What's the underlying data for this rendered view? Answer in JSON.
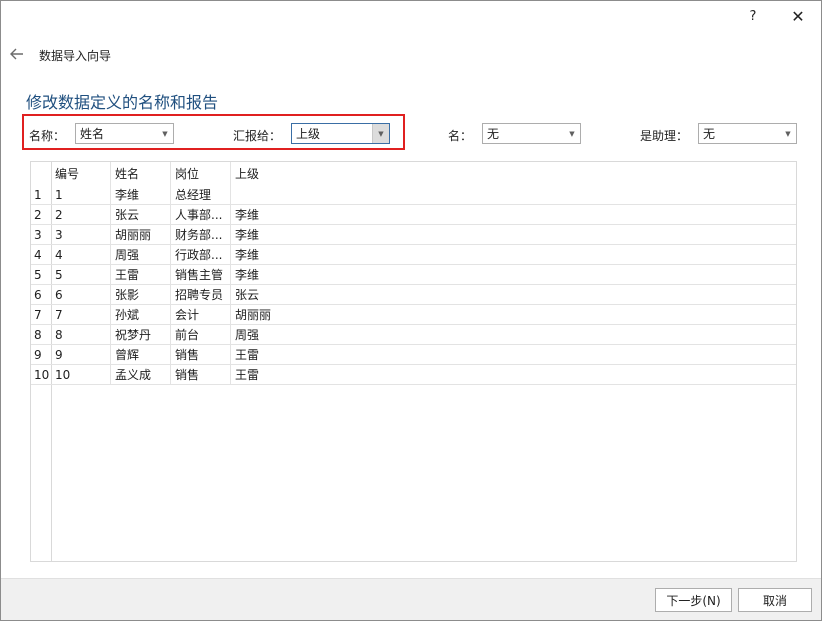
{
  "titlebar": {
    "help": "?",
    "close": "✕"
  },
  "wizard": {
    "title": "数据导入向导",
    "heading": "修改数据定义的名称和报告"
  },
  "fields": {
    "name_label": "名称：",
    "name_value": "姓名",
    "report_label": "汇报给：",
    "report_value": "上级",
    "ming_label": "名：",
    "ming_value": "无",
    "assistant_label": "是助理：",
    "assistant_value": "无"
  },
  "table": {
    "columns": [
      "编号",
      "姓名",
      "岗位",
      "上级"
    ],
    "rows": [
      [
        "1",
        "1",
        "李维",
        "总经理",
        ""
      ],
      [
        "2",
        "2",
        "张云",
        "人事部...",
        "李维"
      ],
      [
        "3",
        "3",
        "胡丽丽",
        "财务部...",
        "李维"
      ],
      [
        "4",
        "4",
        "周强",
        "行政部...",
        "李维"
      ],
      [
        "5",
        "5",
        "王雷",
        "销售主管",
        "李维"
      ],
      [
        "6",
        "6",
        "张影",
        "招聘专员",
        "张云"
      ],
      [
        "7",
        "7",
        "孙斌",
        "会计",
        "胡丽丽"
      ],
      [
        "8",
        "8",
        "祝梦丹",
        "前台",
        "周强"
      ],
      [
        "9",
        "9",
        "曾辉",
        "销售",
        "王雷"
      ],
      [
        "10",
        "10",
        "孟义成",
        "销售",
        "王雷"
      ]
    ]
  },
  "buttons": {
    "next": "下一步(N)",
    "cancel": "取消"
  },
  "colors": {
    "highlight": "#e02020",
    "heading": "#1f4f7f"
  }
}
